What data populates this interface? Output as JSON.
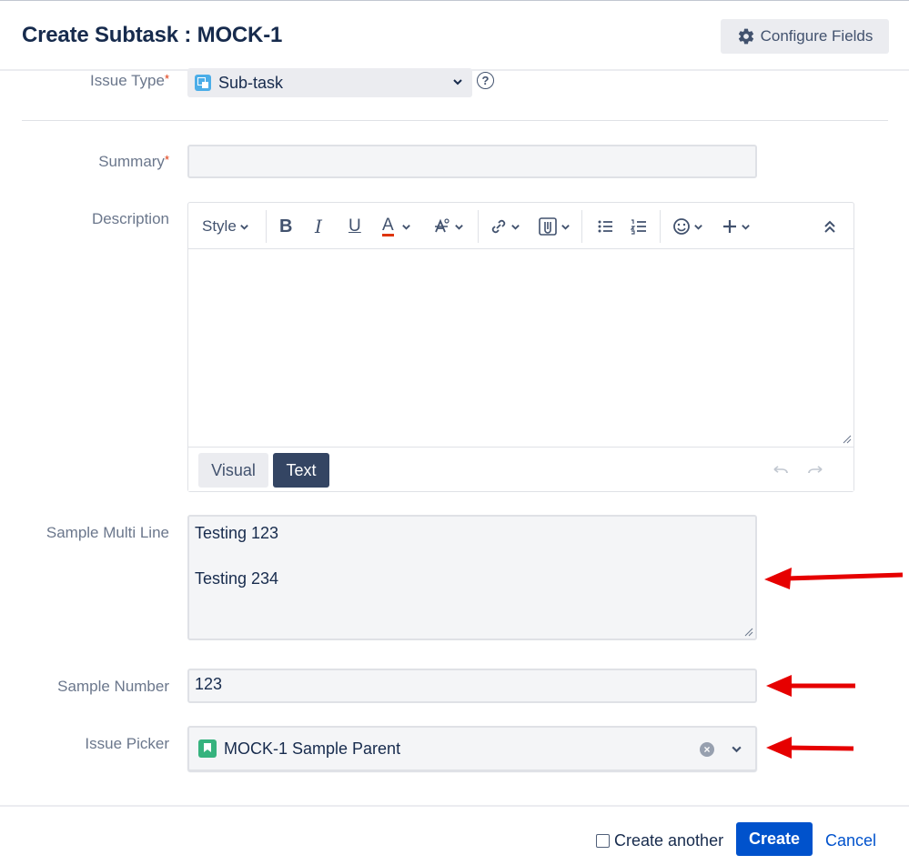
{
  "dialog": {
    "title": "Create Subtask : MOCK-1",
    "configure_fields_label": "Configure Fields"
  },
  "fields": {
    "issue_type": {
      "label": "Issue Type",
      "required_marker": "*",
      "value": "Sub-task",
      "icon": "subtask-icon"
    },
    "summary": {
      "label": "Summary",
      "required_marker": "*",
      "value": ""
    },
    "description": {
      "label": "Description",
      "toolbar": {
        "style_label": "Style",
        "buttons": [
          "bold",
          "italic",
          "underline",
          "text-color",
          "text-format",
          "link",
          "attachment",
          "bullet-list",
          "numbered-list",
          "emoji",
          "insert-more",
          "collapse-toolbar"
        ]
      },
      "value": "",
      "mode_visual": "Visual",
      "mode_text": "Text",
      "active_mode": "Text"
    },
    "sample_multi_line": {
      "label": "Sample Multi Line",
      "line1": "Testing 123",
      "line2": "Testing 234"
    },
    "sample_number": {
      "label": "Sample Number",
      "value": "123"
    },
    "issue_picker": {
      "label": "Issue Picker",
      "value": "MOCK-1 Sample Parent",
      "icon": "story-icon"
    }
  },
  "footer": {
    "create_another_label": "Create another",
    "create_another_checked": false,
    "create_label": "Create",
    "cancel_label": "Cancel"
  },
  "colors": {
    "primary": "#0052cc",
    "annotation_arrow": "#e60000",
    "required": "#de350b",
    "text_mode_active": "#344563"
  }
}
